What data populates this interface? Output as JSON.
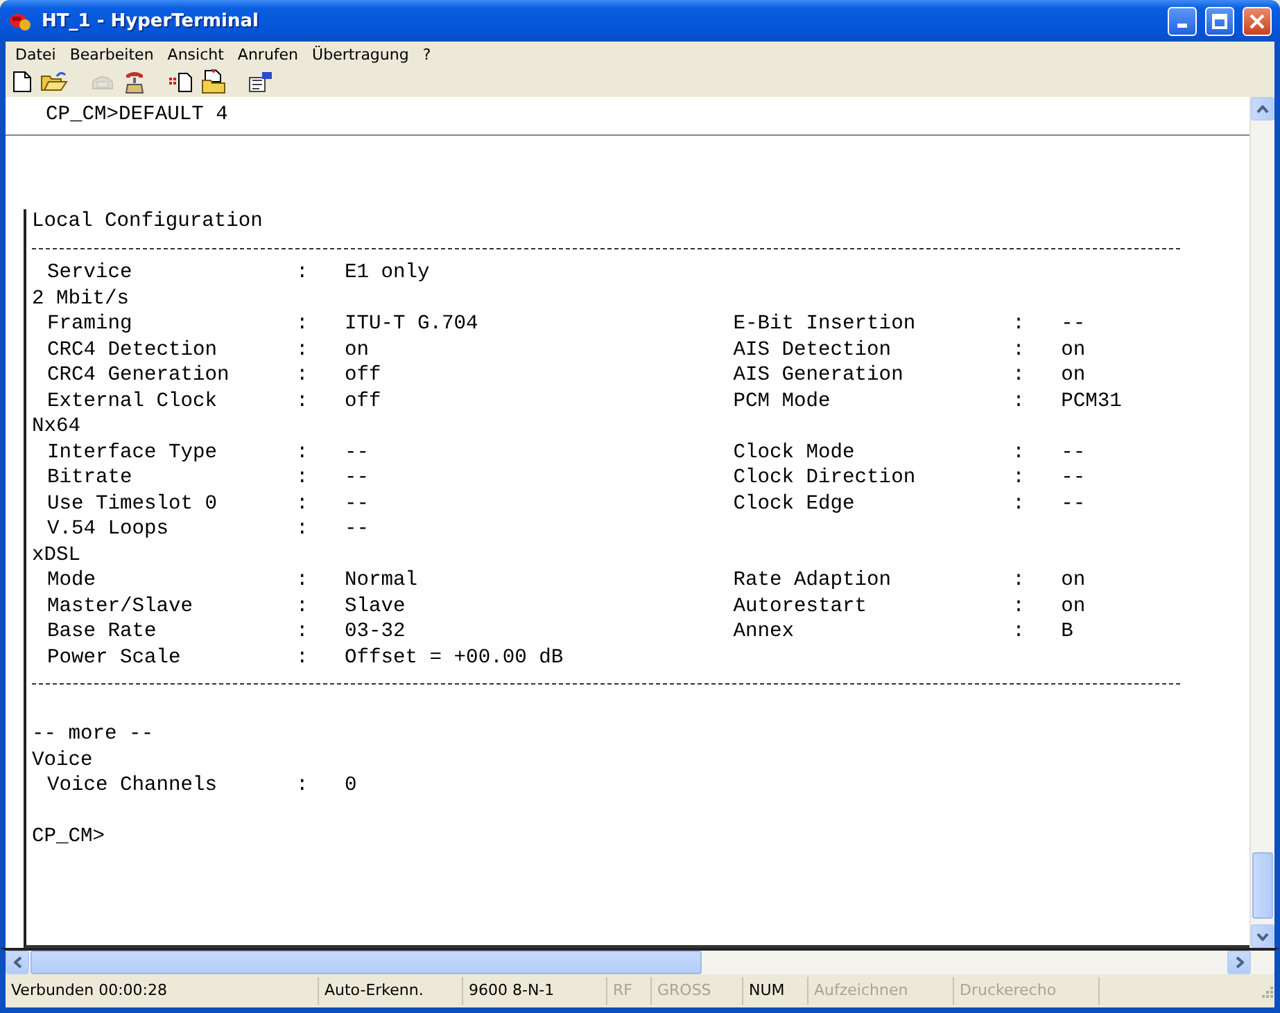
{
  "window": {
    "title": "HT_1 - HyperTerminal"
  },
  "menu": [
    {
      "label": "Datei"
    },
    {
      "label": "Bearbeiten"
    },
    {
      "label": "Ansicht"
    },
    {
      "label": "Anrufen"
    },
    {
      "label": "Übertragung"
    },
    {
      "label": "?"
    }
  ],
  "toolbar": [
    {
      "kind": "new",
      "disabled": false
    },
    {
      "kind": "open",
      "disabled": false
    },
    {
      "kind": "call",
      "disabled": true
    },
    {
      "kind": "hangup",
      "disabled": false
    },
    {
      "kind": "send",
      "disabled": false
    },
    {
      "kind": "receive",
      "disabled": false
    },
    {
      "kind": "properties",
      "disabled": false
    }
  ],
  "terminal": {
    "command": "CP_CM>DEFAULT 4",
    "heading": "Local Configuration",
    "groups": [
      {
        "rows": [
          {
            "label": "Service",
            "sep": ":",
            "value": "E1 only"
          }
        ]
      },
      {
        "title": "2 Mbit/s",
        "rows": [
          {
            "label": "Framing",
            "sep": ":",
            "value": "ITU-T G.704",
            "right_label": "E-Bit Insertion",
            "right_sep": ":",
            "right_value": "--"
          },
          {
            "label": "CRC4 Detection",
            "sep": ":",
            "value": "on",
            "right_label": "AIS Detection",
            "right_sep": ":",
            "right_value": "on"
          },
          {
            "label": "CRC4 Generation",
            "sep": ":",
            "value": "off",
            "right_label": "AIS Generation",
            "right_sep": ":",
            "right_value": "on"
          },
          {
            "label": "External Clock",
            "sep": ":",
            "value": "off",
            "right_label": "PCM Mode",
            "right_sep": ":",
            "right_value": "PCM31"
          }
        ]
      },
      {
        "title": "Nx64",
        "rows": [
          {
            "label": "Interface Type",
            "sep": ":",
            "value": "--",
            "right_label": "Clock Mode",
            "right_sep": ":",
            "right_value": "--"
          },
          {
            "label": "Bitrate",
            "sep": ":",
            "value": "--",
            "right_label": "Clock Direction",
            "right_sep": ":",
            "right_value": "--"
          },
          {
            "label": "Use Timeslot 0",
            "sep": ":",
            "value": "--",
            "right_label": "Clock Edge",
            "right_sep": ":",
            "right_value": "--"
          },
          {
            "label": "V.54 Loops",
            "sep": ":",
            "value": "--"
          }
        ]
      },
      {
        "title": "xDSL",
        "rows": [
          {
            "label": "Mode",
            "sep": ":",
            "value": "Normal",
            "right_label": "Rate Adaption",
            "right_sep": ":",
            "right_value": "on"
          },
          {
            "label": "Master/Slave",
            "sep": ":",
            "value": "Slave",
            "right_label": "Autorestart",
            "right_sep": ":",
            "right_value": "on"
          },
          {
            "label": "Base Rate",
            "sep": ":",
            "value": "03-32",
            "right_label": "Annex",
            "right_sep": ":",
            "right_value": "B"
          },
          {
            "label": "Power Scale",
            "sep": ":",
            "value": "Offset = +00.00 dB"
          }
        ]
      }
    ],
    "more": "-- more --",
    "after_groups": [
      {
        "title": "Voice",
        "rows": [
          {
            "label": "Voice Channels",
            "sep": ":",
            "value": "0"
          }
        ]
      }
    ],
    "prompt": "CP_CM>"
  },
  "status_bar": [
    {
      "text": "Verbunden 00:00:28",
      "enabled": true
    },
    {
      "text": "Auto-Erkenn.",
      "enabled": true
    },
    {
      "text": "9600 8-N-1",
      "enabled": true
    },
    {
      "text": "RF",
      "enabled": false
    },
    {
      "text": "GROSS",
      "enabled": false
    },
    {
      "text": "NUM",
      "enabled": true
    },
    {
      "text": "Aufzeichnen",
      "enabled": false
    },
    {
      "text": "Druckerecho",
      "enabled": false
    }
  ]
}
